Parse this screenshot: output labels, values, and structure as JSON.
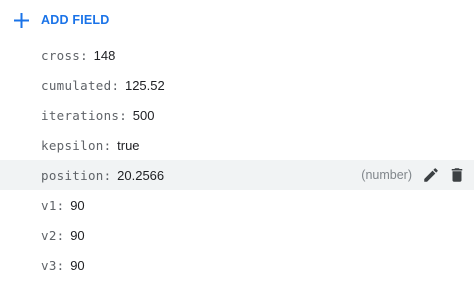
{
  "toolbar": {
    "add_field_label": "ADD FIELD",
    "add_icon": "plus-icon"
  },
  "fields": [
    {
      "key": "cross",
      "value": "148"
    },
    {
      "key": "cumulated",
      "value": "125.52"
    },
    {
      "key": "iterations",
      "value": "500"
    },
    {
      "key": "kepsilon",
      "value": "true"
    },
    {
      "key": "position",
      "value": "20.2566",
      "type_hint": "(number)",
      "hovered": true
    },
    {
      "key": "v1",
      "value": "90"
    },
    {
      "key": "v2",
      "value": "90"
    },
    {
      "key": "v3",
      "value": "90"
    }
  ],
  "row_actions": {
    "edit_icon": "pencil-icon",
    "delete_icon": "trash-icon"
  },
  "colors": {
    "accent": "#1a73e8",
    "key_text": "#5f6368",
    "value_text": "#202124",
    "hover_bg": "#f1f3f4",
    "icon": "#3c4043"
  }
}
